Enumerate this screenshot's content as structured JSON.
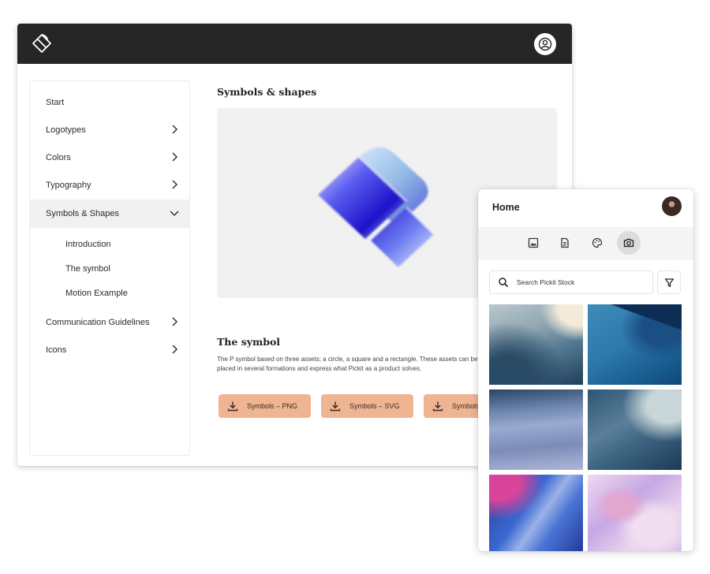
{
  "sidebar": {
    "items": [
      {
        "label": "Start"
      },
      {
        "label": "Logotypes"
      },
      {
        "label": "Colors"
      },
      {
        "label": "Typography"
      },
      {
        "label": "Symbols & Shapes"
      },
      {
        "label": "Communication Guidelines"
      },
      {
        "label": "Icons"
      }
    ],
    "sub_items": [
      {
        "label": "Introduction"
      },
      {
        "label": "The symbol"
      },
      {
        "label": "Motion Example"
      }
    ]
  },
  "content": {
    "title": "Symbols & shapes",
    "section_title": "The symbol",
    "section_text": "The P symbol based on three assets; a circle, a square and a rectangle. These assets can be placed in several formations and express what Pickit as a product solves.",
    "buttons": [
      "Symbols – PNG",
      "Symbols – SVG",
      "Symbols – AI"
    ]
  },
  "panel": {
    "title": "Home",
    "tabs": [
      {
        "icon": "image-icon"
      },
      {
        "icon": "document-icon"
      },
      {
        "icon": "palette-icon"
      },
      {
        "icon": "camera-icon",
        "active": true
      }
    ],
    "search_placeholder": "Search Pickit Stock"
  },
  "colors": {
    "topbar": "#262626",
    "button": "#efb592",
    "active_nav": "#f1f1f1"
  }
}
